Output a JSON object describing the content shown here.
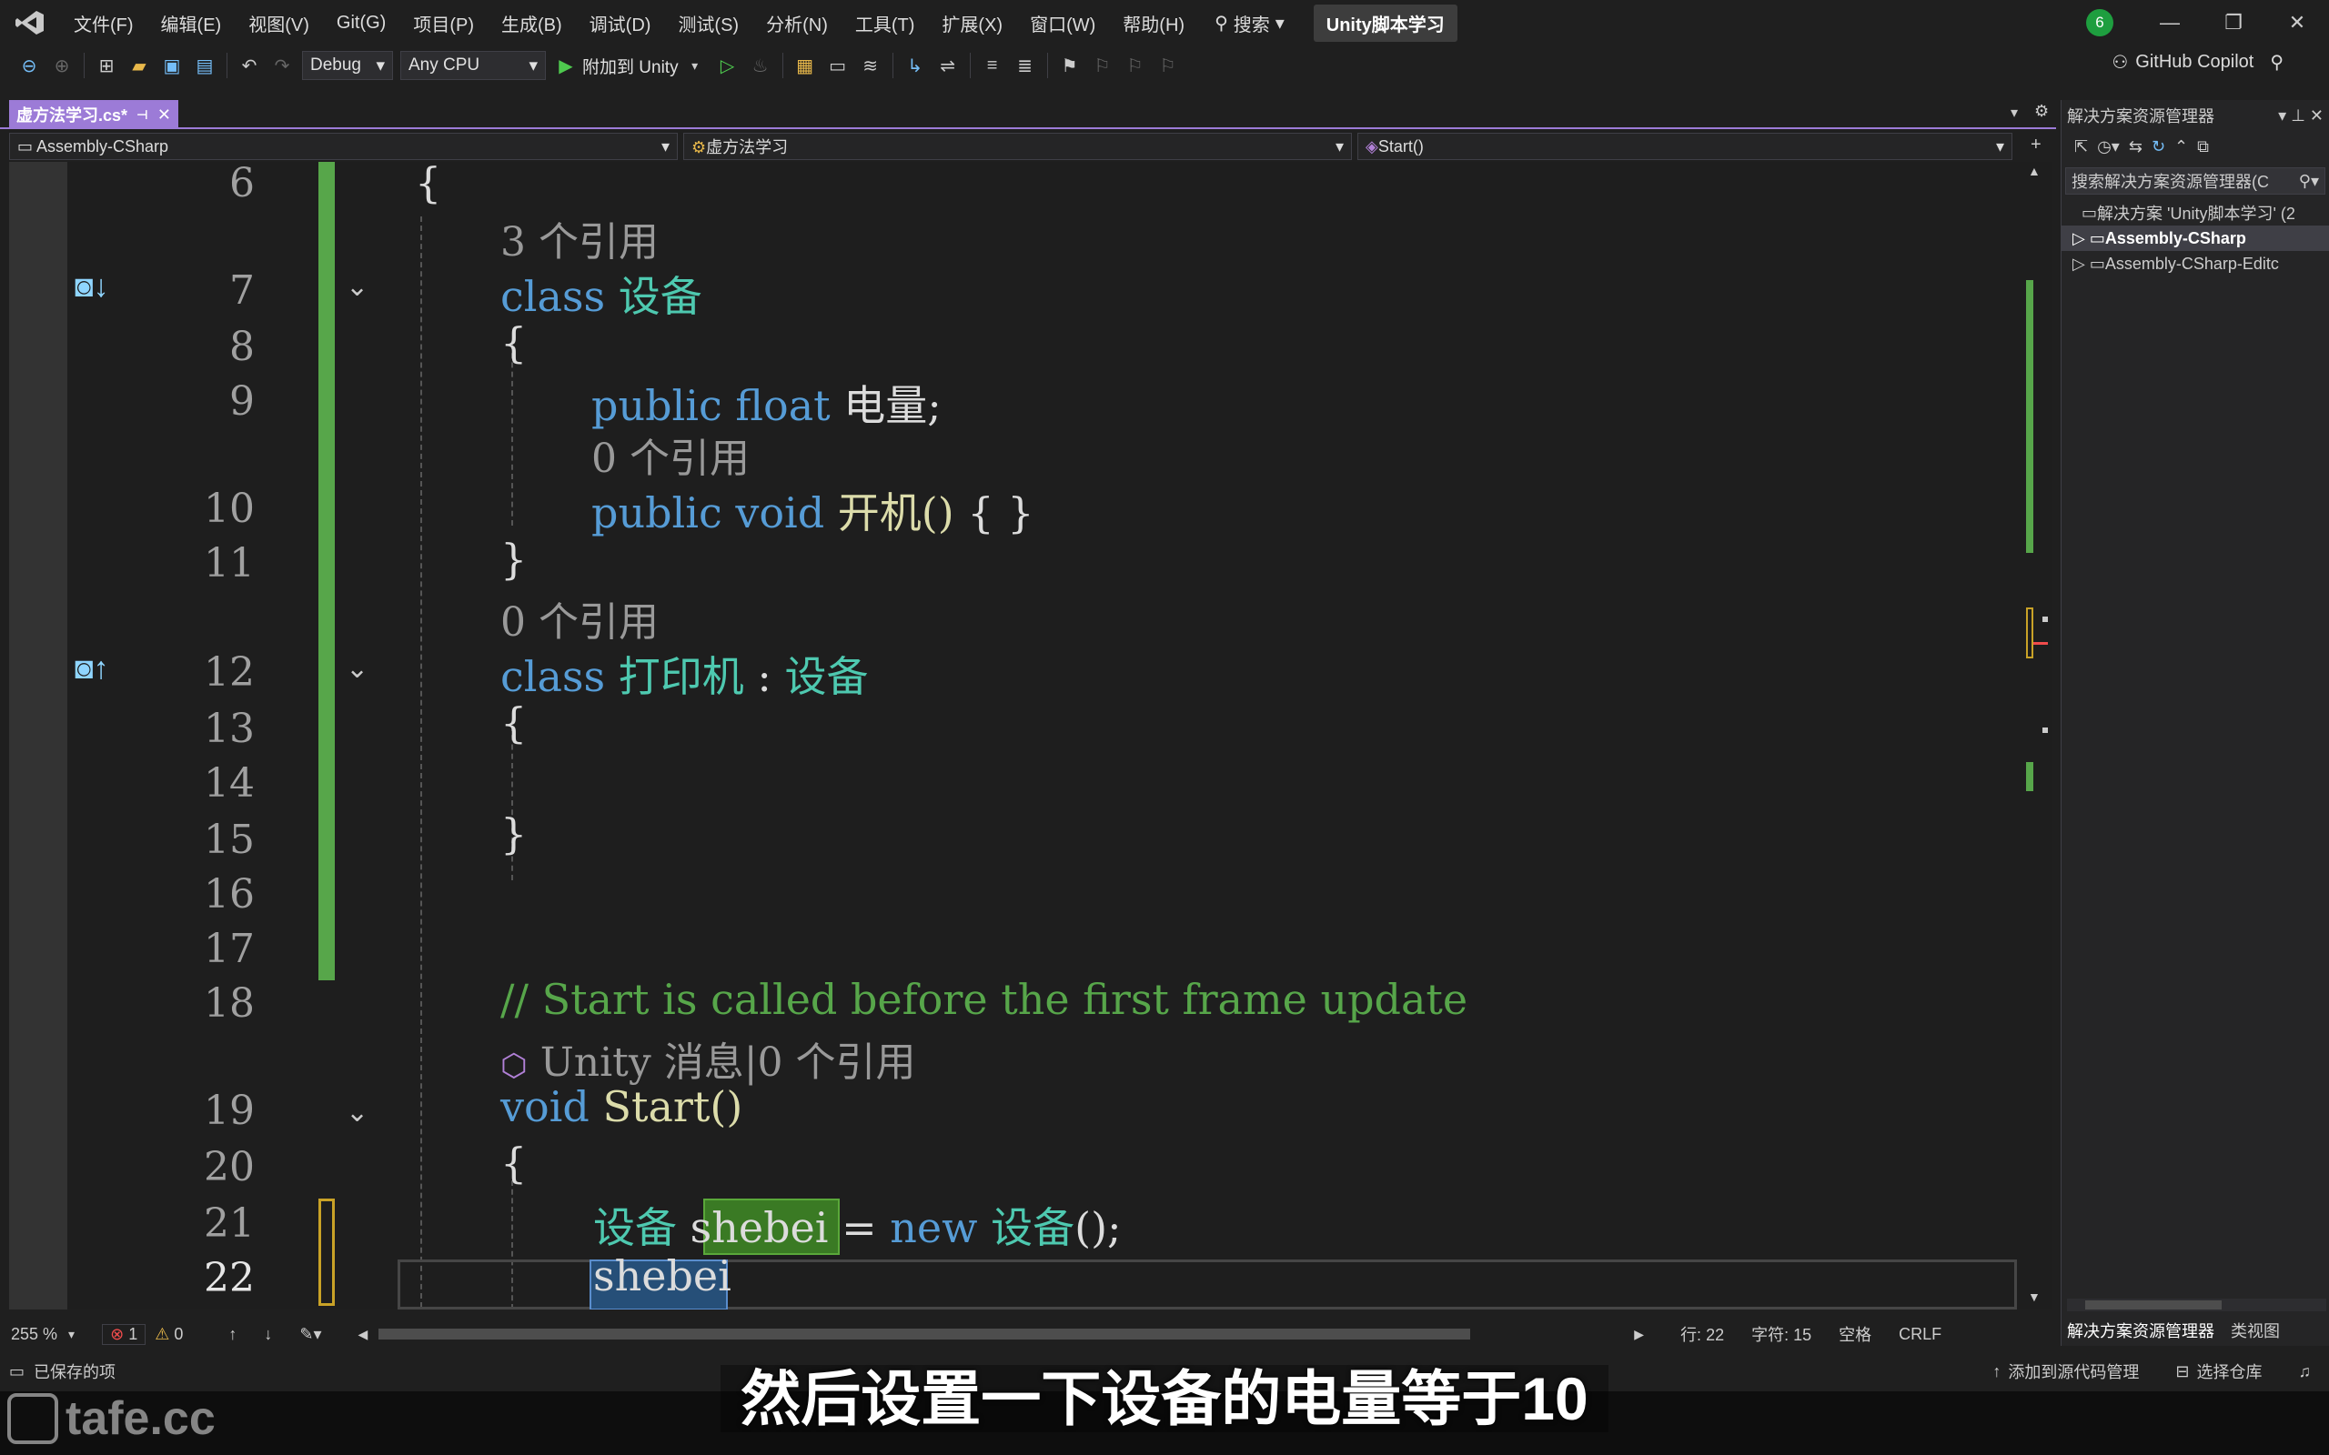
{
  "menu": {
    "items": [
      "文件(F)",
      "编辑(E)",
      "视图(V)",
      "Git(G)",
      "项目(P)",
      "生成(B)",
      "调试(D)",
      "测试(S)",
      "分析(N)",
      "工具(T)",
      "扩展(X)",
      "窗口(W)",
      "帮助(H)"
    ],
    "search_label": "搜索",
    "project_title": "Unity脚本学习",
    "notification_count": "6"
  },
  "toolbar": {
    "config": "Debug",
    "platform": "Any CPU",
    "attach_label": "附加到 Unity",
    "copilot_label": "GitHub Copilot"
  },
  "tab": {
    "name": "虚方法学习.cs*"
  },
  "nav": {
    "project": "Assembly-CSharp",
    "class": "虚方法学习",
    "member": "Start()"
  },
  "code": {
    "lines": [
      {
        "num": "6",
        "text": "{"
      },
      {
        "lens": "3 个引用"
      },
      {
        "num": "7",
        "kw": "class",
        "name": "设备"
      },
      {
        "num": "8",
        "text": "{"
      },
      {
        "num": "9",
        "kw": "public float",
        "name": "电量;"
      },
      {
        "lens": "0 个引用"
      },
      {
        "num": "10",
        "kw": "public void",
        "name": "开机()",
        "rest": "{ }"
      },
      {
        "num": "11",
        "text": "}"
      },
      {
        "lens": "0 个引用"
      },
      {
        "num": "12",
        "kw": "class",
        "name": "打印机",
        "rest": ":",
        "base": "设备"
      },
      {
        "num": "13",
        "text": "{"
      },
      {
        "num": "14",
        "text": ""
      },
      {
        "num": "15",
        "text": "}"
      },
      {
        "num": "16",
        "text": ""
      },
      {
        "num": "17",
        "text": ""
      },
      {
        "num": "18",
        "comment": "// Start is called before the first frame update"
      },
      {
        "lens": "Unity 消息|0 个引用"
      },
      {
        "num": "19",
        "kw": "void",
        "name": "Start()"
      },
      {
        "num": "20",
        "text": "{"
      },
      {
        "num": "21",
        "type": "设备",
        "var": "shebei",
        "op": "=",
        "kw": "new",
        "call": "设备",
        "end": "();"
      },
      {
        "num": "22",
        "var": "shebei"
      }
    ]
  },
  "status": {
    "zoom": "255 %",
    "errors": "1",
    "warnings": "0",
    "line": "行: 22",
    "char": "字符: 15",
    "spacing": "空格",
    "eol": "CRLF",
    "saved": "已保存的项",
    "add_source": "添加到源代码管理",
    "select_repo": "选择仓库"
  },
  "solution": {
    "title": "解决方案资源管理器",
    "search_placeholder": "搜索解决方案资源管理器(C",
    "root": "解决方案 'Unity脚本学习' (2",
    "items": [
      "Assembly-CSharp",
      "Assembly-CSharp-Editc"
    ],
    "tabs": [
      "解决方案资源管理器",
      "类视图"
    ]
  },
  "subtitle": "然后设置一下设备的电量等于10",
  "watermark": "tafe.cc"
}
